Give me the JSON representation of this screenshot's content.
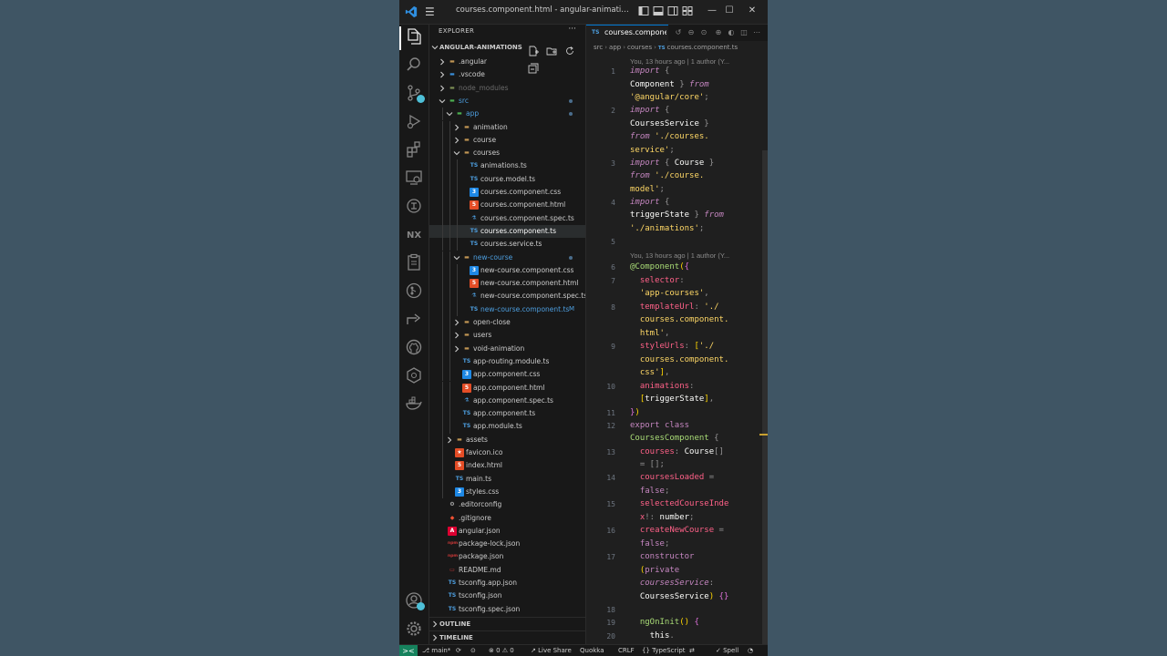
{
  "window": {
    "title": "courses.component.html - angular-animations - Vis..."
  },
  "activity_bar": {
    "items": [
      "explorer",
      "search",
      "source-control",
      "run-debug",
      "extensions",
      "remote-explorer",
      "testing",
      "nx-console",
      "docker",
      "gitlens",
      "live-share",
      "github",
      "kubernetes",
      "container"
    ],
    "bottom": [
      "accounts",
      "manage"
    ]
  },
  "sidebar": {
    "title": "EXPLORER",
    "more": "···",
    "root_label": "ANGULAR-ANIMATIONS",
    "rows": [
      {
        "label": ".angular",
        "icon": "folder",
        "indent": 0,
        "chev": "right",
        "color": "#cccccc"
      },
      {
        "label": ".vscode",
        "icon": "folder-vscode",
        "indent": 0,
        "chev": "right",
        "color": "#cccccc"
      },
      {
        "label": "node_modules",
        "icon": "folder-node",
        "indent": 0,
        "chev": "right",
        "color": "#6a6a6a"
      },
      {
        "label": "src",
        "icon": "folder-src",
        "indent": 0,
        "chev": "down",
        "color": "#4d9fe0",
        "dot": true
      },
      {
        "label": "app",
        "icon": "folder-app",
        "indent": 1,
        "chev": "down",
        "color": "#4d9fe0",
        "dot": true
      },
      {
        "label": "animation",
        "icon": "folder",
        "indent": 2,
        "chev": "right",
        "color": "#cccccc"
      },
      {
        "label": "course",
        "icon": "folder",
        "indent": 2,
        "chev": "right",
        "color": "#cccccc"
      },
      {
        "label": "courses",
        "icon": "folder",
        "indent": 2,
        "chev": "down",
        "color": "#cccccc"
      },
      {
        "label": "animations.ts",
        "icon": "ts",
        "indent": 3,
        "color": "#cccccc"
      },
      {
        "label": "course.model.ts",
        "icon": "ts",
        "indent": 3,
        "color": "#cccccc"
      },
      {
        "label": "courses.component.css",
        "icon": "css",
        "indent": 3,
        "color": "#cccccc"
      },
      {
        "label": "courses.component.html",
        "icon": "html",
        "indent": 3,
        "color": "#cccccc"
      },
      {
        "label": "courses.component.spec.ts",
        "icon": "spec",
        "indent": 3,
        "color": "#cccccc"
      },
      {
        "label": "courses.component.ts",
        "icon": "ts",
        "indent": 3,
        "color": "#ffffff",
        "selected": true
      },
      {
        "label": "courses.service.ts",
        "icon": "ts",
        "indent": 3,
        "color": "#cccccc"
      },
      {
        "label": "new-course",
        "icon": "folder",
        "indent": 2,
        "chev": "down",
        "color": "#4d9fe0",
        "dot": true
      },
      {
        "label": "new-course.component.css",
        "icon": "css",
        "indent": 3,
        "color": "#cccccc"
      },
      {
        "label": "new-course.component.html",
        "icon": "html",
        "indent": 3,
        "color": "#cccccc"
      },
      {
        "label": "new-course.component.spec.ts",
        "icon": "spec",
        "indent": 3,
        "color": "#cccccc"
      },
      {
        "label": "new-course.component.ts",
        "icon": "ts",
        "indent": 3,
        "color": "#4d9fe0",
        "badge": "M"
      },
      {
        "label": "open-close",
        "icon": "folder",
        "indent": 2,
        "chev": "right",
        "color": "#cccccc"
      },
      {
        "label": "users",
        "icon": "folder",
        "indent": 2,
        "chev": "right",
        "color": "#cccccc"
      },
      {
        "label": "void-animation",
        "icon": "folder",
        "indent": 2,
        "chev": "right",
        "color": "#cccccc"
      },
      {
        "label": "app-routing.module.ts",
        "icon": "ts",
        "indent": 2,
        "color": "#cccccc"
      },
      {
        "label": "app.component.css",
        "icon": "css",
        "indent": 2,
        "color": "#cccccc"
      },
      {
        "label": "app.component.html",
        "icon": "html",
        "indent": 2,
        "color": "#cccccc"
      },
      {
        "label": "app.component.spec.ts",
        "icon": "spec",
        "indent": 2,
        "color": "#cccccc"
      },
      {
        "label": "app.component.ts",
        "icon": "ts",
        "indent": 2,
        "color": "#cccccc"
      },
      {
        "label": "app.module.ts",
        "icon": "ts",
        "indent": 2,
        "color": "#cccccc"
      },
      {
        "label": "assets",
        "icon": "folder",
        "indent": 1,
        "chev": "right",
        "color": "#cccccc"
      },
      {
        "label": "favicon.ico",
        "icon": "star",
        "indent": 1,
        "color": "#cccccc"
      },
      {
        "label": "index.html",
        "icon": "html",
        "indent": 1,
        "color": "#cccccc"
      },
      {
        "label": "main.ts",
        "icon": "ts",
        "indent": 1,
        "color": "#cccccc"
      },
      {
        "label": "styles.css",
        "icon": "css",
        "indent": 1,
        "color": "#cccccc"
      },
      {
        "label": ".editorconfig",
        "icon": "gear",
        "indent": 0,
        "color": "#cccccc"
      },
      {
        "label": ".gitignore",
        "icon": "git",
        "indent": 0,
        "color": "#cccccc"
      },
      {
        "label": "angular.json",
        "icon": "angular",
        "indent": 0,
        "color": "#cccccc"
      },
      {
        "label": "package-lock.json",
        "icon": "npm",
        "indent": 0,
        "color": "#cccccc"
      },
      {
        "label": "package.json",
        "icon": "npm",
        "indent": 0,
        "color": "#cccccc"
      },
      {
        "label": "README.md",
        "icon": "md",
        "indent": 0,
        "color": "#cccccc"
      },
      {
        "label": "tsconfig.app.json",
        "icon": "tsconfig",
        "indent": 0,
        "color": "#cccccc"
      },
      {
        "label": "tsconfig.json",
        "icon": "tsconfig",
        "indent": 0,
        "color": "#cccccc"
      },
      {
        "label": "tsconfig.spec.json",
        "icon": "tsconfig",
        "indent": 0,
        "color": "#cccccc"
      }
    ],
    "sections": [
      "OUTLINE",
      "TIMELINE"
    ]
  },
  "editor": {
    "tab": {
      "icon": "TS",
      "label": "courses.compone"
    },
    "breadcrumbs": [
      "src",
      "app",
      "courses",
      "courses.component.ts"
    ],
    "blame_1": "You, 13 hours ago | 1 author (Y...",
    "blame_2": "You, 13 hours ago | 1 author (Y...",
    "lines": [
      {
        "n": "1",
        "tokens": [
          [
            "kw",
            "import "
          ],
          [
            "punc",
            "{"
          ]
        ]
      },
      {
        "n": "",
        "tokens": [
          [
            "id",
            "Component "
          ],
          [
            "punc",
            "} "
          ],
          [
            "kw",
            "from"
          ]
        ]
      },
      {
        "n": "",
        "tokens": [
          [
            "str",
            "'@angular/core'"
          ],
          [
            "punc",
            ";"
          ]
        ]
      },
      {
        "n": "2",
        "tokens": [
          [
            "kw",
            "import "
          ],
          [
            "punc",
            "{"
          ]
        ]
      },
      {
        "n": "",
        "tokens": [
          [
            "id",
            "CoursesService "
          ],
          [
            "punc",
            "}"
          ]
        ]
      },
      {
        "n": "",
        "tokens": [
          [
            "kw",
            "from "
          ],
          [
            "str",
            "'./courses."
          ]
        ]
      },
      {
        "n": "",
        "tokens": [
          [
            "str",
            "service'"
          ],
          [
            "punc",
            ";"
          ]
        ]
      },
      {
        "n": "3",
        "tokens": [
          [
            "kw",
            "import "
          ],
          [
            "punc",
            "{ "
          ],
          [
            "id",
            "Course "
          ],
          [
            "punc",
            "}"
          ]
        ]
      },
      {
        "n": "",
        "tokens": [
          [
            "kw",
            "from "
          ],
          [
            "str",
            "'./course."
          ]
        ]
      },
      {
        "n": "",
        "tokens": [
          [
            "str",
            "model'"
          ],
          [
            "punc",
            ";"
          ]
        ]
      },
      {
        "n": "4",
        "tokens": [
          [
            "kw",
            "import "
          ],
          [
            "punc",
            "{"
          ]
        ]
      },
      {
        "n": "",
        "tokens": [
          [
            "id",
            "triggerState "
          ],
          [
            "punc",
            "} "
          ],
          [
            "kw",
            "from"
          ]
        ]
      },
      {
        "n": "",
        "tokens": [
          [
            "str",
            "'./animations'"
          ],
          [
            "punc",
            ";"
          ]
        ]
      },
      {
        "n": "5",
        "tokens": []
      },
      {
        "n": "6",
        "tokens": [
          [
            "deco",
            "@Component"
          ],
          [
            "paren",
            "("
          ],
          [
            "brace",
            "{"
          ]
        ]
      },
      {
        "n": "7",
        "tokens": [
          [
            "id",
            "  "
          ],
          [
            "prop",
            "selector"
          ],
          [
            "punc",
            ":"
          ]
        ]
      },
      {
        "n": "",
        "tokens": [
          [
            "id",
            "  "
          ],
          [
            "str",
            "'app-courses'"
          ],
          [
            "punc",
            ","
          ]
        ]
      },
      {
        "n": "8",
        "tokens": [
          [
            "id",
            "  "
          ],
          [
            "prop",
            "templateUrl"
          ],
          [
            "punc",
            ": "
          ],
          [
            "str",
            "'./"
          ]
        ]
      },
      {
        "n": "",
        "tokens": [
          [
            "id",
            "  "
          ],
          [
            "str",
            "courses.component."
          ]
        ]
      },
      {
        "n": "",
        "tokens": [
          [
            "id",
            "  "
          ],
          [
            "str",
            "html'"
          ],
          [
            "punc",
            ","
          ]
        ]
      },
      {
        "n": "9",
        "tokens": [
          [
            "id",
            "  "
          ],
          [
            "prop",
            "styleUrls"
          ],
          [
            "punc",
            ": "
          ],
          [
            "paren",
            "["
          ],
          [
            "str",
            "'./"
          ]
        ]
      },
      {
        "n": "",
        "tokens": [
          [
            "id",
            "  "
          ],
          [
            "str",
            "courses.component."
          ]
        ]
      },
      {
        "n": "",
        "tokens": [
          [
            "id",
            "  "
          ],
          [
            "str",
            "css'"
          ],
          [
            "paren",
            "]"
          ],
          [
            "punc",
            ","
          ]
        ]
      },
      {
        "n": "10",
        "tokens": [
          [
            "id",
            "  "
          ],
          [
            "prop",
            "animations"
          ],
          [
            "punc",
            ":"
          ]
        ]
      },
      {
        "n": "",
        "tokens": [
          [
            "id",
            "  "
          ],
          [
            "paren",
            "["
          ],
          [
            "id",
            "triggerState"
          ],
          [
            "paren",
            "]"
          ],
          [
            "punc",
            ","
          ]
        ]
      },
      {
        "n": "11",
        "tokens": [
          [
            "brace",
            "}"
          ],
          [
            "paren",
            ")"
          ]
        ]
      },
      {
        "n": "12",
        "tokens": [
          [
            "kw2",
            "export "
          ],
          [
            "kw2",
            "class"
          ]
        ]
      },
      {
        "n": "",
        "tokens": [
          [
            "fn",
            "CoursesComponent "
          ],
          [
            "punc",
            "{"
          ]
        ]
      },
      {
        "n": "13",
        "tokens": [
          [
            "id",
            "  "
          ],
          [
            "prop",
            "courses"
          ],
          [
            "punc",
            ": "
          ],
          [
            "id",
            "Course"
          ],
          [
            "punc",
            "[]"
          ]
        ]
      },
      {
        "n": "",
        "tokens": [
          [
            "id",
            "  "
          ],
          [
            "punc",
            "= [];"
          ]
        ]
      },
      {
        "n": "14",
        "tokens": [
          [
            "id",
            "  "
          ],
          [
            "prop",
            "coursesLoaded "
          ],
          [
            "punc",
            "="
          ]
        ]
      },
      {
        "n": "",
        "tokens": [
          [
            "id",
            "  "
          ],
          [
            "kw2",
            "false"
          ],
          [
            "punc",
            ";"
          ]
        ]
      },
      {
        "n": "15",
        "tokens": [
          [
            "id",
            "  "
          ],
          [
            "prop",
            "selectedCourseInde"
          ]
        ]
      },
      {
        "n": "",
        "tokens": [
          [
            "id",
            "  "
          ],
          [
            "prop",
            "x"
          ],
          [
            "punc",
            "!: "
          ],
          [
            "id",
            "number"
          ],
          [
            "punc",
            ";"
          ]
        ]
      },
      {
        "n": "16",
        "tokens": [
          [
            "id",
            "  "
          ],
          [
            "prop",
            "createNewCourse "
          ],
          [
            "punc",
            "="
          ]
        ]
      },
      {
        "n": "",
        "tokens": [
          [
            "id",
            "  "
          ],
          [
            "kw2",
            "false"
          ],
          [
            "punc",
            ";"
          ]
        ]
      },
      {
        "n": "17",
        "tokens": [
          [
            "id",
            "  "
          ],
          [
            "kw2",
            "constructor"
          ]
        ]
      },
      {
        "n": "",
        "tokens": [
          [
            "id",
            "  "
          ],
          [
            "paren",
            "("
          ],
          [
            "kw2",
            "private"
          ]
        ]
      },
      {
        "n": "",
        "tokens": [
          [
            "id",
            "  "
          ],
          [
            "kw",
            "coursesService"
          ],
          [
            "punc",
            ":"
          ]
        ]
      },
      {
        "n": "",
        "tokens": [
          [
            "id",
            "  "
          ],
          [
            "id",
            "CoursesService"
          ],
          [
            "paren",
            ")"
          ],
          [
            "id",
            " "
          ],
          [
            "brace",
            "{}"
          ]
        ]
      },
      {
        "n": "18",
        "tokens": []
      },
      {
        "n": "19",
        "tokens": [
          [
            "id",
            "  "
          ],
          [
            "fn",
            "ngOnInit"
          ],
          [
            "paren",
            "()"
          ],
          [
            "id",
            " "
          ],
          [
            "brace",
            "{"
          ]
        ]
      },
      {
        "n": "20",
        "tokens": [
          [
            "id",
            "    "
          ],
          [
            "id",
            "this"
          ],
          [
            "punc",
            "."
          ]
        ]
      }
    ]
  },
  "statusbar": {
    "remote": "><",
    "branch": "main*",
    "sync": "⟳",
    "errors": "⊗ 0 ⚠ 0",
    "liveshare": "Live Share",
    "quokka": "Quokka",
    "eol": "CRLF",
    "language": "{} TypeScript",
    "spell": "✓ Spell",
    "bell": "🔔"
  }
}
